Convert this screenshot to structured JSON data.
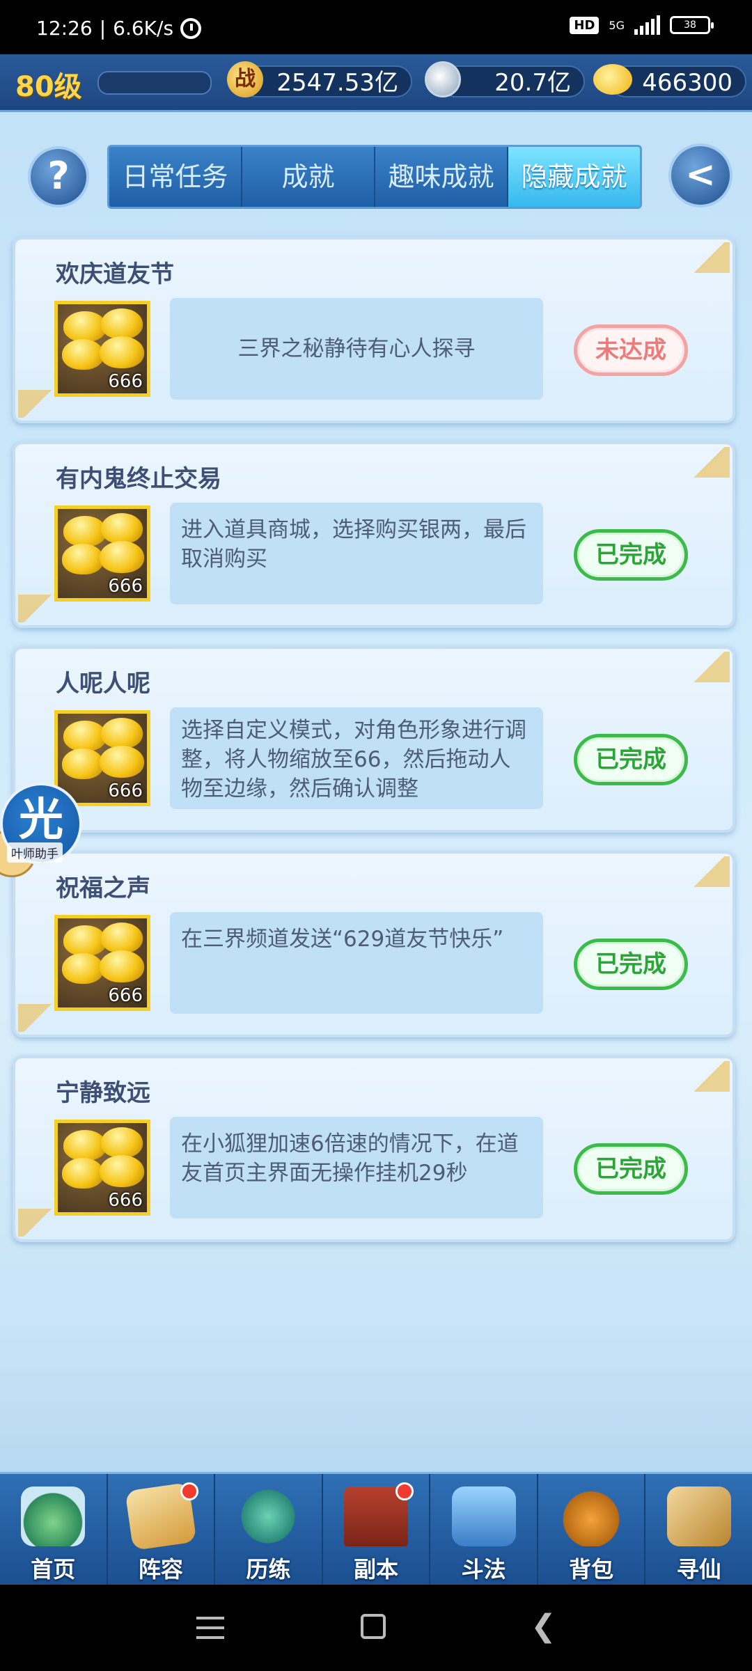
{
  "status_bar": {
    "time": "12:26",
    "separator": "|",
    "net_speed": "6.6K/s",
    "hd_badge": "HD",
    "network": "5G",
    "battery": "38"
  },
  "resources": {
    "level": "80级",
    "battle_icon_text": "战",
    "battle_power": "2547.53亿",
    "silver": "20.7亿",
    "gold": "466300"
  },
  "header": {
    "help_symbol": "?",
    "back_symbol": "<",
    "tabs": [
      {
        "label": "日常任务",
        "active": false
      },
      {
        "label": "成就",
        "active": false
      },
      {
        "label": "趣味成就",
        "active": false
      },
      {
        "label": "隐藏成就",
        "active": true
      }
    ]
  },
  "achievements": [
    {
      "title": "欢庆道友节",
      "reward_count": "666",
      "description": "三界之秘静待有心人探寻",
      "status": "未达成",
      "completed": false
    },
    {
      "title": "有内鬼终止交易",
      "reward_count": "666",
      "description": "进入道具商城，选择购买银两，最后取消购买",
      "status": "已完成",
      "completed": true
    },
    {
      "title": "人呢人呢",
      "reward_count": "666",
      "description": "选择自定义模式，对角色形象进行调整，将人物缩放至66，然后拖动人物至边缘，然后确认调整",
      "status": "已完成",
      "completed": true
    },
    {
      "title": "祝福之声",
      "reward_count": "666",
      "description": "在三界频道发送“629道友节快乐”",
      "status": "已完成",
      "completed": true
    },
    {
      "title": "宁静致远",
      "reward_count": "666",
      "description": "在小狐狸加速6倍速的情况下，在道友首页主界面无操作挂机29秒",
      "status": "已完成",
      "completed": true
    }
  ],
  "floating_helper": {
    "icon_char": "光",
    "label": "叶师助手"
  },
  "bottom_nav": [
    {
      "label": "首页",
      "badge": false
    },
    {
      "label": "阵容",
      "badge": true
    },
    {
      "label": "历练",
      "badge": false
    },
    {
      "label": "副本",
      "badge": true
    },
    {
      "label": "斗法",
      "badge": false
    },
    {
      "label": "背包",
      "badge": false
    },
    {
      "label": "寻仙",
      "badge": false
    }
  ]
}
